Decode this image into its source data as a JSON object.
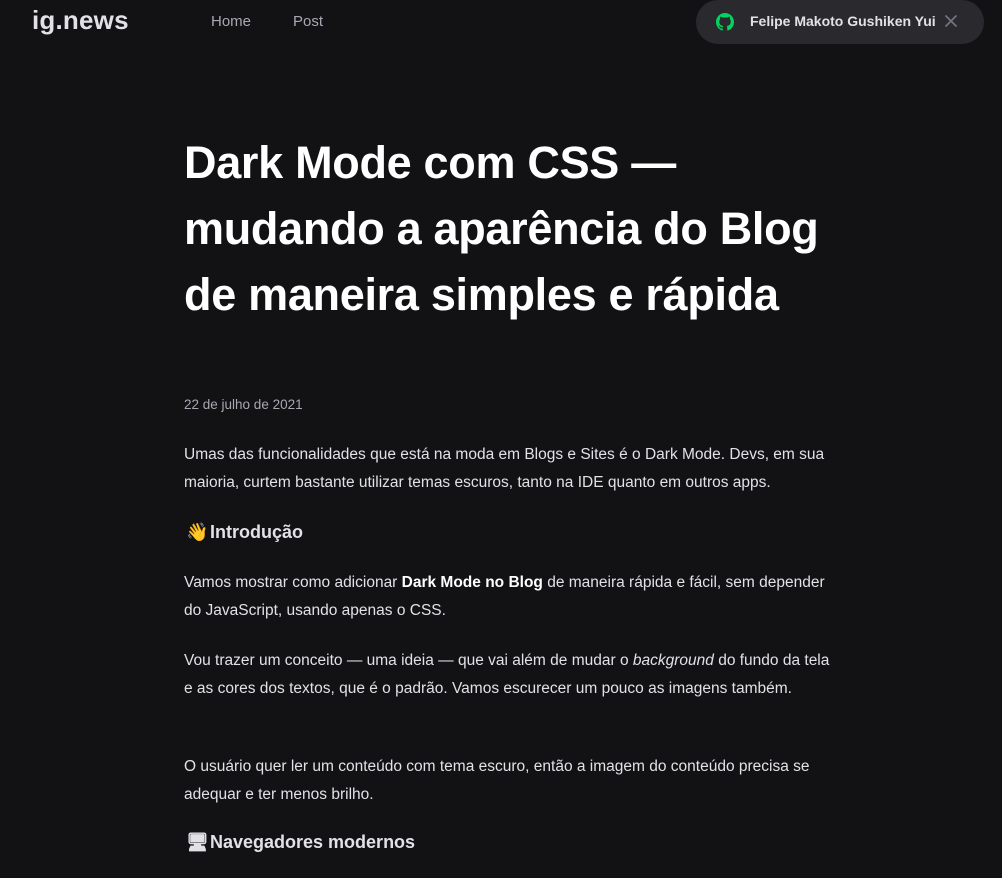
{
  "header": {
    "logo": "ig.news",
    "nav": [
      {
        "label": "Home"
      },
      {
        "label": "Post"
      }
    ],
    "user": {
      "name": "Felipe Makoto Gushiken Yui",
      "icon": "github-icon",
      "close_icon": "close-icon"
    }
  },
  "article": {
    "title": "Dark Mode com CSS — mudando a aparência do Blog de maneira simples e rápida",
    "date": "22 de julho de 2021",
    "p1": "Umas das funcionalidades que está na moda em Blogs e Sites é o Dark Mode. Devs, em sua maioria, curtem bastante utilizar temas escuros, tanto na IDE quanto em outros apps.",
    "h_intro": {
      "emoji": "👋",
      "text": "Introdução"
    },
    "p2": {
      "before": "Vamos mostrar como adicionar ",
      "strong": "Dark Mode no Blog",
      "after": " de maneira rápida e fácil, sem depender do JavaScript, usando apenas o CSS."
    },
    "p3": {
      "before": "Vou trazer um conceito — uma ideia — que vai além de mudar o ",
      "em": "background",
      "after": " do fundo da tela e as cores dos textos, que é o padrão. Vamos escurecer um pouco as imagens também."
    },
    "p4": "O usuário quer ler um conteúdo com tema escuro, então a imagem do conteúdo precisa se adequar e ter menos brilho.",
    "h_nav": {
      "emoji": "🖥",
      "text": "Navegadores modernos"
    }
  },
  "colors": {
    "background": "#121214",
    "pill": "#29292e",
    "github_green": "#04d361",
    "text": "#e1e1e6",
    "muted": "#a8a8b3"
  }
}
